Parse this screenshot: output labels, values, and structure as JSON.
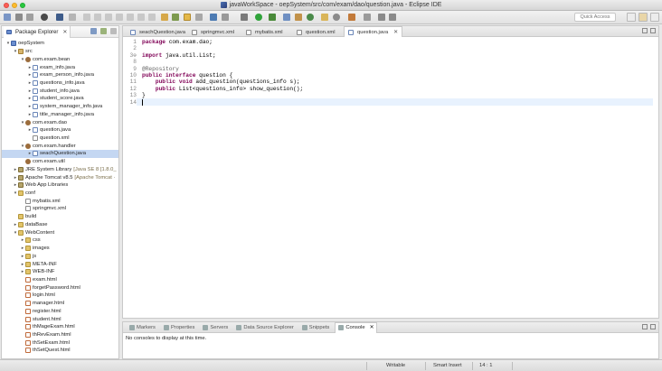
{
  "window": {
    "title": "javaWorkSpace - oepSystem/src/com/exam/dao/question.java - Eclipse IDE"
  },
  "toolbar": {
    "quick_access_placeholder": "Quick Access"
  },
  "package_explorer": {
    "title": "Package Explorer",
    "rows": [
      {
        "label": "oepSystem",
        "depth": 0,
        "twisty": "▾",
        "icon": "proj"
      },
      {
        "label": "src",
        "depth": 1,
        "twisty": "▾",
        "icon": "src"
      },
      {
        "label": "com.exam.bean",
        "depth": 2,
        "twisty": "▾",
        "icon": "pkg"
      },
      {
        "label": "exam_info.java",
        "depth": 3,
        "twisty": "▸",
        "icon": "java"
      },
      {
        "label": "exam_person_info.java",
        "depth": 3,
        "twisty": "▸",
        "icon": "java"
      },
      {
        "label": "questions_info.java",
        "depth": 3,
        "twisty": "▸",
        "icon": "java"
      },
      {
        "label": "student_info.java",
        "depth": 3,
        "twisty": "▸",
        "icon": "java"
      },
      {
        "label": "student_score.java",
        "depth": 3,
        "twisty": "▸",
        "icon": "java"
      },
      {
        "label": "system_manager_info.java",
        "depth": 3,
        "twisty": "▸",
        "icon": "java"
      },
      {
        "label": "title_manager_info.java",
        "depth": 3,
        "twisty": "▸",
        "icon": "java"
      },
      {
        "label": "com.exam.dao",
        "depth": 2,
        "twisty": "▾",
        "icon": "pkg"
      },
      {
        "label": "question.java",
        "depth": 3,
        "twisty": "▸",
        "icon": "java"
      },
      {
        "label": "question.xml",
        "depth": 3,
        "twisty": "",
        "icon": "xml"
      },
      {
        "label": "com.exam.handler",
        "depth": 2,
        "twisty": "▾",
        "icon": "pkg"
      },
      {
        "label": "seachQuestion.java",
        "depth": 3,
        "twisty": "▸",
        "icon": "java",
        "selected": true
      },
      {
        "label": "com.exam.util",
        "depth": 2,
        "twisty": "",
        "icon": "pkg"
      },
      {
        "label": "JRE System Library",
        "suffix": "[Java SE 8 [1.8.0_",
        "depth": 1,
        "twisty": "▸",
        "icon": "lib"
      },
      {
        "label": "Apache Tomcat v8.5",
        "suffix": "[Apache Tomcat ·",
        "depth": 1,
        "twisty": "▸",
        "icon": "lib"
      },
      {
        "label": "Web App Libraries",
        "depth": 1,
        "twisty": "▸",
        "icon": "lib"
      },
      {
        "label": "conf",
        "depth": 1,
        "twisty": "▾",
        "icon": "folder"
      },
      {
        "label": "mybatis.xml",
        "depth": 2,
        "twisty": "",
        "icon": "xml"
      },
      {
        "label": "springmvc.xml",
        "depth": 2,
        "twisty": "",
        "icon": "xml"
      },
      {
        "label": "build",
        "depth": 1,
        "twisty": "",
        "icon": "folder"
      },
      {
        "label": "dataBase",
        "depth": 1,
        "twisty": "▸",
        "icon": "folder"
      },
      {
        "label": "WebContent",
        "depth": 1,
        "twisty": "▾",
        "icon": "folder"
      },
      {
        "label": "css",
        "depth": 2,
        "twisty": "▸",
        "icon": "folder"
      },
      {
        "label": "images",
        "depth": 2,
        "twisty": "▸",
        "icon": "folder"
      },
      {
        "label": "js",
        "depth": 2,
        "twisty": "▸",
        "icon": "folder"
      },
      {
        "label": "META-INF",
        "depth": 2,
        "twisty": "▸",
        "icon": "folder"
      },
      {
        "label": "WEB-INF",
        "depth": 2,
        "twisty": "▸",
        "icon": "folder"
      },
      {
        "label": "exam.html",
        "depth": 2,
        "twisty": "",
        "icon": "html"
      },
      {
        "label": "forgetPassword.html",
        "depth": 2,
        "twisty": "",
        "icon": "html"
      },
      {
        "label": "login.html",
        "depth": 2,
        "twisty": "",
        "icon": "html"
      },
      {
        "label": "manager.html",
        "depth": 2,
        "twisty": "",
        "icon": "html"
      },
      {
        "label": "register.html",
        "depth": 2,
        "twisty": "",
        "icon": "html"
      },
      {
        "label": "student.html",
        "depth": 2,
        "twisty": "",
        "icon": "html"
      },
      {
        "label": "thMageExam.html",
        "depth": 2,
        "twisty": "",
        "icon": "html"
      },
      {
        "label": "thRevExam.html",
        "depth": 2,
        "twisty": "",
        "icon": "html"
      },
      {
        "label": "thSetExam.html",
        "depth": 2,
        "twisty": "",
        "icon": "html"
      },
      {
        "label": "thSetQuest.html",
        "depth": 2,
        "twisty": "",
        "icon": "html"
      }
    ]
  },
  "editor": {
    "tabs": [
      {
        "label": "seachQuestion.java",
        "icon": "java"
      },
      {
        "label": "springmvc.xml",
        "icon": "xml"
      },
      {
        "label": "mybatis.xml",
        "icon": "xml"
      },
      {
        "label": "question.xml",
        "icon": "xml"
      },
      {
        "label": "question.java",
        "icon": "java",
        "active": true
      }
    ],
    "lines": [
      {
        "num": "1",
        "parts": [
          {
            "t": "package",
            "c": "kw"
          },
          {
            "t": " com.exam.dao;"
          }
        ]
      },
      {
        "num": "2",
        "parts": []
      },
      {
        "num": "3⊕",
        "parts": [
          {
            "t": "import",
            "c": "kw"
          },
          {
            "t": " java.util.List;"
          }
        ]
      },
      {
        "num": "8",
        "parts": []
      },
      {
        "num": "9",
        "parts": [
          {
            "t": "@Repository",
            "c": "an"
          }
        ]
      },
      {
        "num": "10",
        "parts": [
          {
            "t": "public",
            "c": "kw"
          },
          {
            "t": " "
          },
          {
            "t": "interface",
            "c": "kw"
          },
          {
            "t": " question {"
          }
        ]
      },
      {
        "num": "11",
        "parts": [
          {
            "t": "    "
          },
          {
            "t": "public",
            "c": "kw"
          },
          {
            "t": " "
          },
          {
            "t": "void",
            "c": "kw"
          },
          {
            "t": " add_question(questions_info s);"
          }
        ]
      },
      {
        "num": "12",
        "parts": [
          {
            "t": "    "
          },
          {
            "t": "public",
            "c": "kw"
          },
          {
            "t": " List<questions_info> show_question();"
          }
        ]
      },
      {
        "num": "13",
        "parts": [
          {
            "t": "}"
          }
        ]
      },
      {
        "num": "14",
        "parts": [],
        "current": true
      }
    ]
  },
  "console_view": {
    "tabs": [
      {
        "label": "Markers"
      },
      {
        "label": "Properties"
      },
      {
        "label": "Servers"
      },
      {
        "label": "Data Source Explorer"
      },
      {
        "label": "Snippets"
      },
      {
        "label": "Console",
        "active": true
      }
    ],
    "message": "No consoles to display at this time."
  },
  "status": {
    "mode": "Writable",
    "insert": "Smart Insert",
    "position": "14 : 1"
  },
  "colors": {
    "selection": "#c4d7f2",
    "keyword": "#7f0055",
    "annotation": "#646464",
    "current_line": "#e8f2fe"
  }
}
